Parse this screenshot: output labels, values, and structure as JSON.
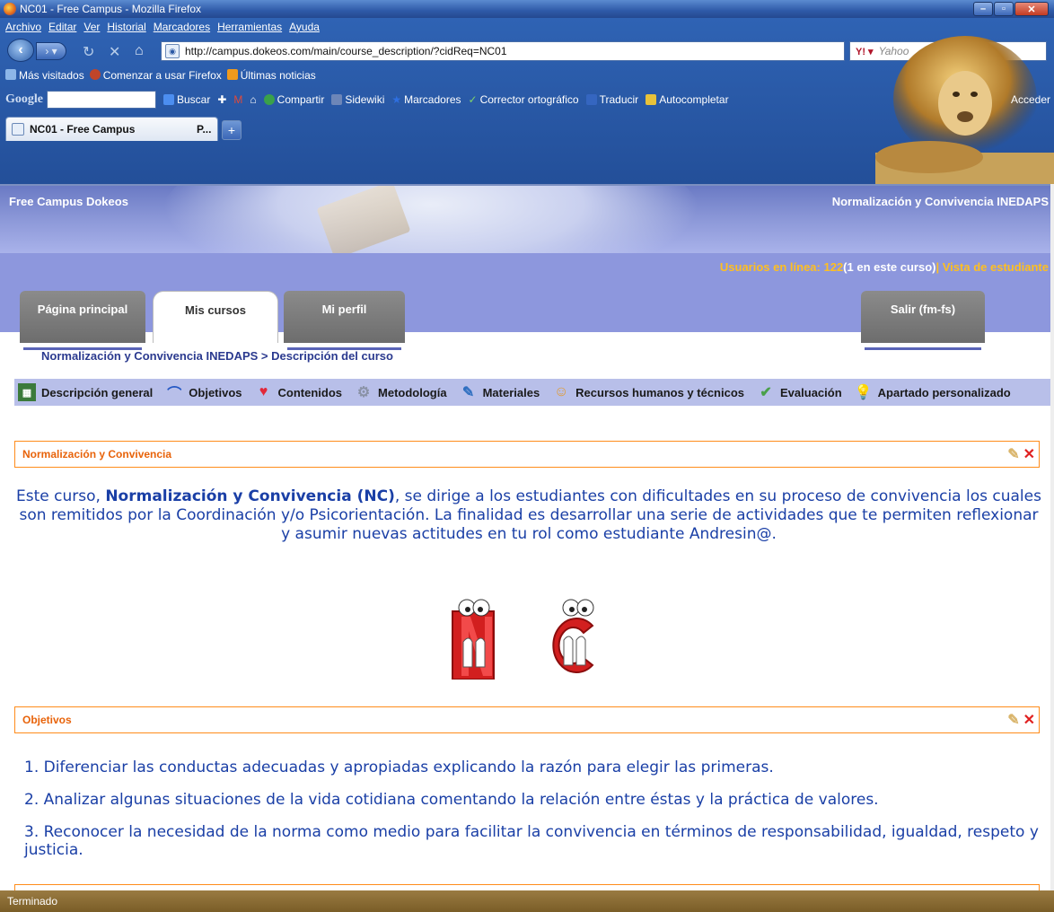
{
  "window": {
    "title": "NC01 - Free Campus - Mozilla Firefox"
  },
  "menu": [
    "Archivo",
    "Editar",
    "Ver",
    "Historial",
    "Marcadores",
    "Herramientas",
    "Ayuda"
  ],
  "nav": {
    "url": "http://campus.dokeos.com/main/course_description/?cidReq=NC01",
    "search_placeholder": "Yahoo"
  },
  "bookmarks": [
    "Más visitados",
    "Comenzar a usar Firefox",
    "Últimas noticias"
  ],
  "google_toolbar": {
    "logo": "Google",
    "items": [
      "Buscar",
      "Compartir",
      "Sidewiki",
      "Marcadores",
      "Corrector ortográfico",
      "Traducir",
      "Autocompletar",
      "Acceder"
    ]
  },
  "tabs": [
    {
      "label": "NC01 - Free Campus"
    },
    {
      "label": "P..."
    }
  ],
  "site": {
    "name": "Free Campus  Dokeos",
    "course": "Normalización y Convivencia INEDAPS",
    "users_online": "Usuarios en línea: 122",
    "users_in_course": "(1 en este curso)",
    "student_view": "| Vista de estudiante"
  },
  "main_tabs": [
    "Página principal",
    "Mis cursos",
    "Mi perfil",
    "Salir (fm-fs)"
  ],
  "breadcrumb": "Normalización y Convivencia INEDAPS > Descripción del curso",
  "tools": [
    {
      "label": "Descripción general",
      "icon": "board-icon"
    },
    {
      "label": "Objetivos",
      "icon": "arrow-icon"
    },
    {
      "label": "Contenidos",
      "icon": "heart-icon"
    },
    {
      "label": "Metodología",
      "icon": "gears-icon"
    },
    {
      "label": "Materiales",
      "icon": "tools-icon"
    },
    {
      "label": "Recursos humanos y técnicos",
      "icon": "person-icon"
    },
    {
      "label": "Evaluación",
      "icon": "check-icon"
    },
    {
      "label": "Apartado personalizado",
      "icon": "bulb-icon"
    }
  ],
  "sections": {
    "s1_title": "Normalización y Convivencia",
    "s1_pre": "Este curso, ",
    "s1_bold": "Normalización y Convivencia (NC)",
    "s1_post": ", se dirige a los estudiantes con dificultades en su proceso de convivencia los cuales son remitidos por la Coordinación y/o Psicorientación. La finalidad es desarrollar una serie de actividades que te permiten reflexionar y asumir nuevas actitudes en tu rol como estudiante Andresin@.",
    "s2_title": "Objetivos",
    "objectives": [
      "1. Diferenciar las conductas adecuadas y apropiadas explicando la razón para elegir las primeras.",
      "2. Analizar algunas situaciones de la vida cotidiana comentando la relación entre éstas y la práctica de valores.",
      "3. Reconocer la necesidad de la norma como medio para facilitar la convivencia en términos de responsabilidad, igualdad, respeto y justicia."
    ]
  },
  "status": "Terminado"
}
